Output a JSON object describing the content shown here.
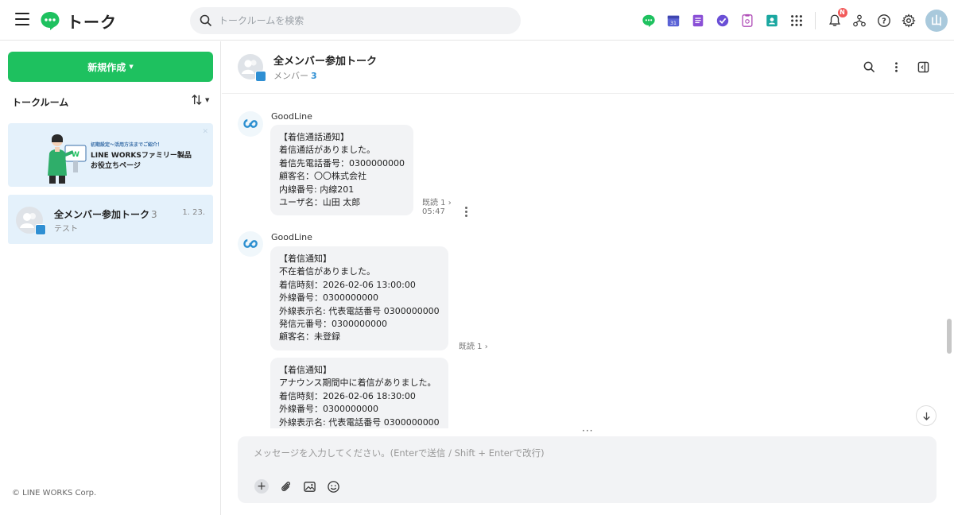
{
  "header": {
    "title": "トーク",
    "search_placeholder": "トークルームを検索",
    "notification_badge": "N",
    "user_initial": "山"
  },
  "sidebar": {
    "new_button_label": "新規作成",
    "room_list_label": "トークルーム",
    "banner": {
      "small_text": "初期設定～活用方法までご紹介！",
      "line1": "LINE WORKSファミリー製品",
      "line2": "お役立ちページ"
    },
    "rooms": [
      {
        "name": "全メンバー参加トーク",
        "count": "3",
        "date": "1. 23.",
        "preview": "テスト"
      }
    ],
    "copyright": "© LINE WORKS Corp."
  },
  "chat": {
    "title": "全メンバー参加トーク",
    "members_label": "メンバー",
    "members_count": "3",
    "messages": [
      {
        "sender": "GoodLine",
        "lines": [
          "【着信通話通知】",
          "着信通話がありました。",
          "着信先電話番号：0300000000",
          "顧客名：〇〇株式会社",
          "内線番号: 内線201",
          "ユーザ名：山田 太郎"
        ],
        "read": "既読 1 ›",
        "time": "05:47"
      },
      {
        "sender": "GoodLine",
        "lines": [
          "【着信通知】",
          "不在着信がありました。",
          "着信時刻：2026-02-06 13:00:00",
          "外線番号：0300000000",
          "外線表示名: 代表電話番号 0300000000",
          "発信元番号：0300000000",
          "顧客名：未登録"
        ],
        "read": "既読 1 ›"
      },
      {
        "lines": [
          "【着信通知】",
          "アナウンス期間中に着信がありました。",
          "着信時刻：2026-02-06 18:30:00",
          "外線番号：0300000000",
          "外線表示名: 代表電話番号 0300000000"
        ]
      }
    ],
    "composer_placeholder": "メッセージを入力してください。(Enterで送信 / Shift + Enterで改行)"
  },
  "colors": {
    "brand_green": "#1ec15f",
    "accent_blue": "#2f8fd3",
    "selected_bg": "#e4f1fb",
    "bubble_bg": "#f2f3f5"
  }
}
